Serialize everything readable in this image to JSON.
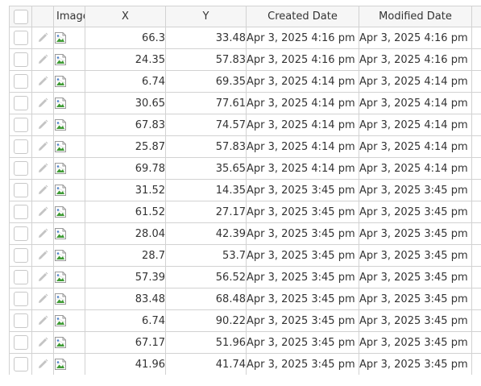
{
  "columns": {
    "image": "Image",
    "x": "X",
    "y": "Y",
    "created": "Created Date",
    "modified": "Modified Date"
  },
  "icons": {
    "edit": "pencil-icon",
    "image": "broken-image-icon"
  },
  "rows": [
    {
      "x": "66.3",
      "y": "33.48",
      "created": "Apr 3, 2025 4:16 pm",
      "modified": "Apr 3, 2025 4:16 pm"
    },
    {
      "x": "24.35",
      "y": "57.83",
      "created": "Apr 3, 2025 4:16 pm",
      "modified": "Apr 3, 2025 4:16 pm"
    },
    {
      "x": "6.74",
      "y": "69.35",
      "created": "Apr 3, 2025 4:14 pm",
      "modified": "Apr 3, 2025 4:14 pm"
    },
    {
      "x": "30.65",
      "y": "77.61",
      "created": "Apr 3, 2025 4:14 pm",
      "modified": "Apr 3, 2025 4:14 pm"
    },
    {
      "x": "67.83",
      "y": "74.57",
      "created": "Apr 3, 2025 4:14 pm",
      "modified": "Apr 3, 2025 4:14 pm"
    },
    {
      "x": "25.87",
      "y": "57.83",
      "created": "Apr 3, 2025 4:14 pm",
      "modified": "Apr 3, 2025 4:14 pm"
    },
    {
      "x": "69.78",
      "y": "35.65",
      "created": "Apr 3, 2025 4:14 pm",
      "modified": "Apr 3, 2025 4:14 pm"
    },
    {
      "x": "31.52",
      "y": "14.35",
      "created": "Apr 3, 2025 3:45 pm",
      "modified": "Apr 3, 2025 3:45 pm"
    },
    {
      "x": "61.52",
      "y": "27.17",
      "created": "Apr 3, 2025 3:45 pm",
      "modified": "Apr 3, 2025 3:45 pm"
    },
    {
      "x": "28.04",
      "y": "42.39",
      "created": "Apr 3, 2025 3:45 pm",
      "modified": "Apr 3, 2025 3:45 pm"
    },
    {
      "x": "28.7",
      "y": "53.7",
      "created": "Apr 3, 2025 3:45 pm",
      "modified": "Apr 3, 2025 3:45 pm"
    },
    {
      "x": "57.39",
      "y": "56.52",
      "created": "Apr 3, 2025 3:45 pm",
      "modified": "Apr 3, 2025 3:45 pm"
    },
    {
      "x": "83.48",
      "y": "68.48",
      "created": "Apr 3, 2025 3:45 pm",
      "modified": "Apr 3, 2025 3:45 pm"
    },
    {
      "x": "6.74",
      "y": "90.22",
      "created": "Apr 3, 2025 3:45 pm",
      "modified": "Apr 3, 2025 3:45 pm"
    },
    {
      "x": "67.17",
      "y": "51.96",
      "created": "Apr 3, 2025 3:45 pm",
      "modified": "Apr 3, 2025 3:45 pm"
    },
    {
      "x": "41.96",
      "y": "41.74",
      "created": "Apr 3, 2025 3:45 pm",
      "modified": "Apr 3, 2025 3:45 pm"
    }
  ]
}
